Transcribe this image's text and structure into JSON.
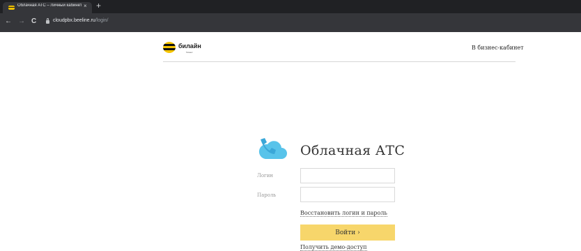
{
  "browser": {
    "tab_title": "Облачная АТС – Личный кабинет",
    "tab_close": "×",
    "new_tab": "+",
    "nav": {
      "back": "←",
      "forward": "→",
      "reload": "C"
    },
    "url_host": "cloudpbx.beeline.ru",
    "url_path": "/login/"
  },
  "header": {
    "brand": "билайн",
    "brand_sub": "бизнес",
    "business_link": "В бизнес-кабинет"
  },
  "login": {
    "product_title": "Облачная АТС",
    "login_label": "Логин",
    "password_label": "Пароль",
    "login_value": "",
    "password_value": "",
    "restore_link": "Восстановить логин и пароль",
    "submit_label": "Войти ›",
    "demo_link": "Получить демо-доступ"
  },
  "colors": {
    "brand_yellow": "#f6c500",
    "button_yellow": "#f7d66b",
    "cloud_blue": "#58c3ea",
    "browser_dark": "#202124"
  },
  "icons": {
    "favicon": "beeline-favicon",
    "cloud": "cloud-phone-icon",
    "lock": "lock-icon"
  }
}
